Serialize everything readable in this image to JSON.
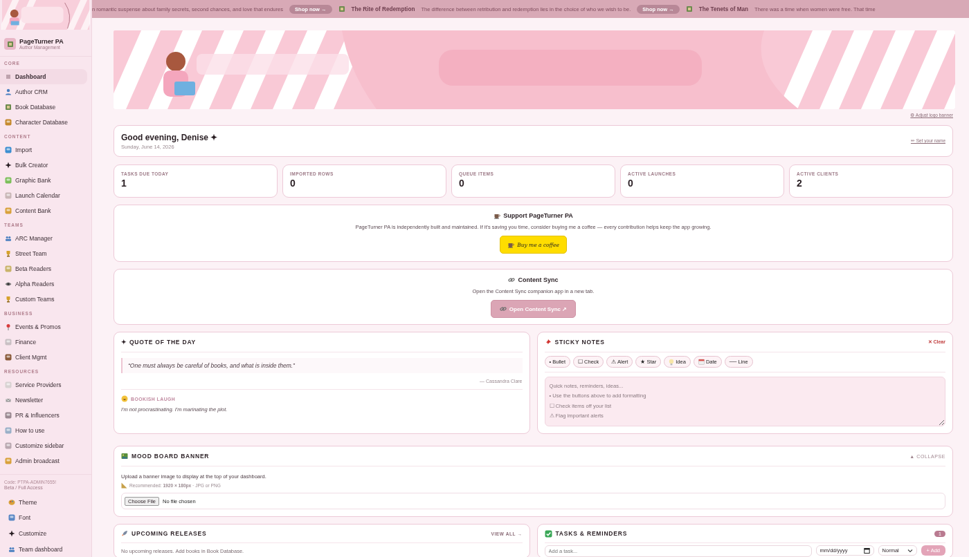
{
  "ticker": {
    "items": [
      {
        "kind": "text",
        "text": "n romantic suspense about family secrets, second chances, and love that endures"
      },
      {
        "kind": "button",
        "text": "Shop now →"
      },
      {
        "kind": "title",
        "text": "The Rite of Redemption"
      },
      {
        "kind": "text",
        "text": "The difference between retribution and redemption lies in the choice of who we wish to be."
      },
      {
        "kind": "button",
        "text": "Shop now →"
      },
      {
        "kind": "title",
        "text": "The Tenets of Man"
      },
      {
        "kind": "text",
        "text": "There was a time when women were free. That time"
      }
    ]
  },
  "sidebar": {
    "brand": {
      "name": "PageTurner PA",
      "subtitle": "Author Management"
    },
    "sections": [
      {
        "label": "CORE",
        "items": [
          {
            "label": "Dashboard",
            "selected": true
          },
          {
            "label": "Author CRM",
            "selected": false
          },
          {
            "label": "Book Database",
            "selected": false
          },
          {
            "label": "Character Database",
            "selected": false
          }
        ]
      },
      {
        "label": "CONTENT",
        "items": [
          {
            "label": "Import",
            "selected": false
          },
          {
            "label": "Bulk Creator",
            "selected": false
          },
          {
            "label": "Graphic Bank",
            "selected": false
          },
          {
            "label": "Launch Calendar",
            "selected": false
          },
          {
            "label": "Content Bank",
            "selected": false
          }
        ]
      },
      {
        "label": "TEAMS",
        "items": [
          {
            "label": "ARC Manager",
            "selected": false
          },
          {
            "label": "Street Team",
            "selected": false
          },
          {
            "label": "Beta Readers",
            "selected": false
          },
          {
            "label": "Alpha Readers",
            "selected": false
          },
          {
            "label": "Custom Teams",
            "selected": false
          }
        ]
      },
      {
        "label": "BUSINESS",
        "items": [
          {
            "label": "Events & Promos",
            "selected": false
          },
          {
            "label": "Finance",
            "selected": false
          },
          {
            "label": "Client Mgmt",
            "selected": false
          }
        ]
      },
      {
        "label": "RESOURCES",
        "items": [
          {
            "label": "Service Providers",
            "selected": false
          },
          {
            "label": "Newsletter",
            "selected": false
          },
          {
            "label": "PR & Influencers",
            "selected": false
          },
          {
            "label": "How to use",
            "selected": false
          },
          {
            "label": "Customize sidebar",
            "selected": false
          },
          {
            "label": "Admin broadcast",
            "selected": false
          }
        ]
      }
    ],
    "access": {
      "code": "Code: PTPA-ADMIN7655!",
      "tier": "Beta / Full Access"
    },
    "footer_items": [
      {
        "label": "Theme"
      },
      {
        "label": "Font"
      },
      {
        "label": "Customize"
      },
      {
        "label": "Team dashboard"
      }
    ]
  },
  "banner": {
    "kind": "picture",
    "link": "⚙ Adjust logo banner"
  },
  "greeting": {
    "title": "Good evening, Denise ✦",
    "date": "Sunday, June 14, 2026",
    "action": "✏ Set your name"
  },
  "stats": [
    {
      "label": "TASKS DUE TODAY",
      "value": "1"
    },
    {
      "label": "IMPORTED ROWS",
      "value": "0"
    },
    {
      "label": "QUEUE ITEMS",
      "value": "0"
    },
    {
      "label": "ACTIVE LAUNCHES",
      "value": "0"
    },
    {
      "label": "ACTIVE CLIENTS",
      "value": "2"
    }
  ],
  "support": {
    "title": "Support PageTurner PA",
    "text": "PageTurner PA is independently built and maintained. If it's saving you time, consider buying me a coffee — every contribution helps keep the app growing.",
    "button": "Buy me a coffee"
  },
  "content_sync": {
    "title": "Content Sync",
    "text": "Open the Content Sync companion app in a new tab.",
    "button": "Open Content Sync ↗"
  },
  "quote": {
    "title": "✦ QUOTE OF THE DAY",
    "text": "“One must always be careful of books, and what is inside them.”",
    "author": "— Cassandra Clare",
    "laugh_title": "BOOKISH LAUGH",
    "laugh": "I'm not procrastinating. I'm marinating the plot."
  },
  "sticky": {
    "title": "STICKY NOTES",
    "clear": "✕ Clear",
    "tools": [
      {
        "kind": "plain",
        "label": "• Bullet"
      },
      {
        "kind": "plain",
        "label": "☐ Check"
      },
      {
        "kind": "plain",
        "label": "⚠ Alert"
      },
      {
        "kind": "plain",
        "label": "★ Star"
      },
      {
        "kind": "bulb",
        "label": "Idea"
      },
      {
        "kind": "calendar",
        "label": "Date"
      },
      {
        "kind": "plain",
        "label": "── Line"
      }
    ],
    "placeholder": "Quick notes, reminders, ideas...\n• Use the buttons above to add formatting\n☐ Check items off your list\n⚠ Flag important alerts"
  },
  "mood": {
    "title": "MOOD BOARD BANNER",
    "toggle": "▲ COLLAPSE",
    "text": "Upload a banner image to display at the top of your dashboard.",
    "hint": "Recommended: **1920 × 180px** · JPG or PNG",
    "file_button": "Choose File",
    "file_status": "No file chosen"
  },
  "releases": {
    "title": "UPCOMING RELEASES",
    "link": "VIEW ALL →",
    "empty": "No upcoming releases. Add books in Book Database."
  },
  "tasks": {
    "title": "TASKS & REMINDERS",
    "count": "1",
    "task_placeholder": "Add a task...",
    "date_placeholder": "mm/dd/yyyy",
    "priority": "Normal",
    "add": "+ Add",
    "add_disabled": true
  }
}
